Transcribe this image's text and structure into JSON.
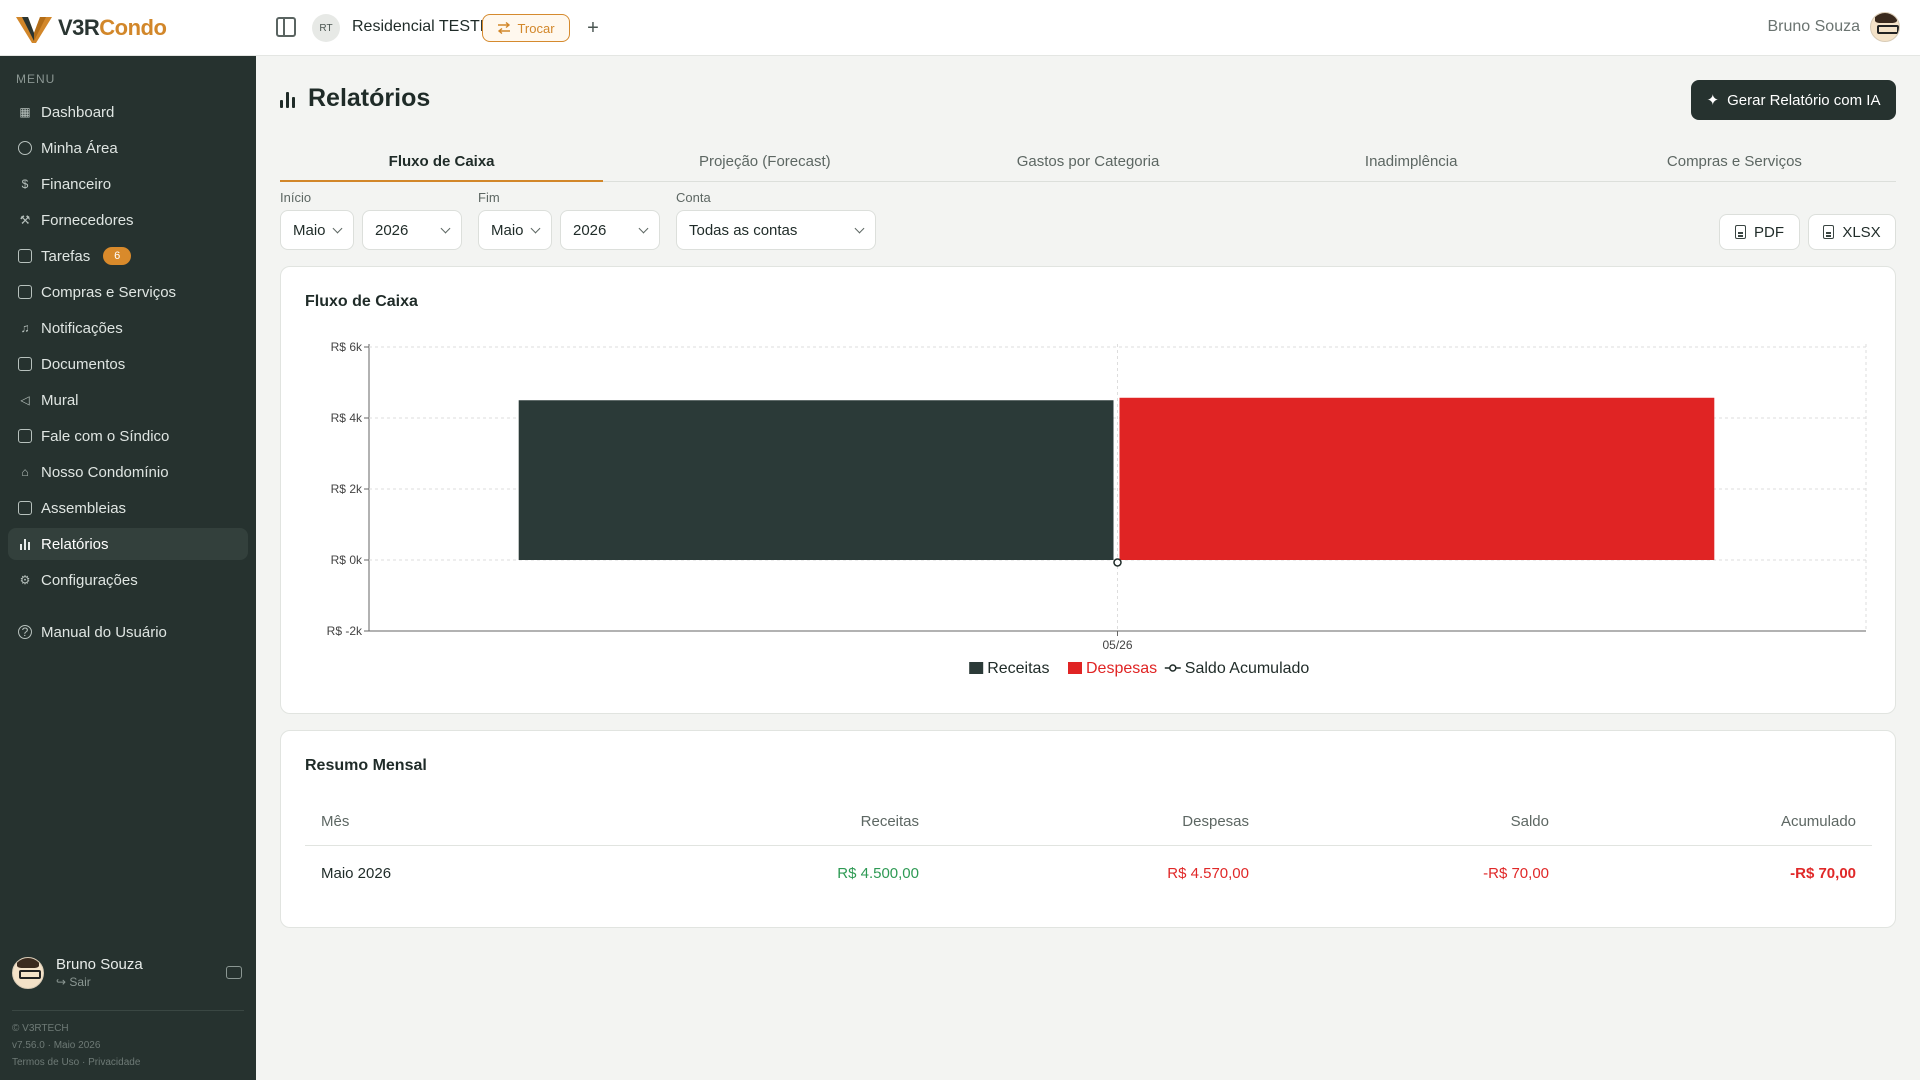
{
  "app": {
    "logo_prefix": "V3R",
    "logo_suffix": "Condo"
  },
  "header": {
    "condo_initials": "RT",
    "condo_name": "Residencial TESTE",
    "switch_label": "Trocar",
    "add_label": "+",
    "user_name": "Bruno Souza"
  },
  "sidebar": {
    "menu_label": "MENU",
    "items": [
      {
        "label": "Dashboard",
        "icon": "dashboard-icon"
      },
      {
        "label": "Minha Área",
        "icon": "user-circle-icon"
      },
      {
        "label": "Financeiro",
        "icon": "dollar-icon"
      },
      {
        "label": "Fornecedores",
        "icon": "wrench-icon"
      },
      {
        "label": "Tarefas",
        "icon": "clipboard-icon",
        "badge": "6"
      },
      {
        "label": "Compras e Serviços",
        "icon": "file-icon"
      },
      {
        "label": "Notificações",
        "icon": "bell-icon"
      },
      {
        "label": "Documentos",
        "icon": "folder-icon"
      },
      {
        "label": "Mural",
        "icon": "megaphone-icon"
      },
      {
        "label": "Fale com o Síndico",
        "icon": "chat-icon"
      },
      {
        "label": "Nosso Condomínio",
        "icon": "home-icon"
      },
      {
        "label": "Assembleias",
        "icon": "clipboard-icon"
      },
      {
        "label": "Relatórios",
        "icon": "bar-chart-icon",
        "active": true
      },
      {
        "label": "Configurações",
        "icon": "gear-icon"
      },
      {
        "label": "Manual do Usuário",
        "icon": "help-icon"
      }
    ],
    "user_name": "Bruno Souza",
    "logout_label": "Sair",
    "footer_company": "© V3RTECH",
    "footer_version": "v7.56.0 · Maio 2026",
    "footer_terms": "Termos de Uso",
    "footer_privacy": "Privacidade"
  },
  "page": {
    "title": "Relatórios",
    "ai_button": "Gerar Relatório com IA",
    "tabs": [
      "Fluxo de Caixa",
      "Projeção (Forecast)",
      "Gastos por Categoria",
      "Inadimplência",
      "Compras e Serviços"
    ],
    "active_tab": 0
  },
  "filters": {
    "start_label": "Início",
    "start_month": "Maio",
    "start_year": "2026",
    "end_label": "Fim",
    "end_month": "Maio",
    "end_year": "2026",
    "account_label": "Conta",
    "account_value": "Todas as contas",
    "pdf_label": "PDF",
    "xlsx_label": "XLSX"
  },
  "chart_card": {
    "title": "Fluxo de Caixa"
  },
  "chart_data": {
    "type": "bar",
    "title": "Fluxo de Caixa",
    "categories": [
      "05/26"
    ],
    "series": [
      {
        "name": "Receitas",
        "kind": "bar",
        "color": "#2b3a38",
        "values": [
          4500
        ]
      },
      {
        "name": "Despesas",
        "kind": "bar",
        "color": "#e02424",
        "values": [
          4570
        ]
      },
      {
        "name": "Saldo Acumulado",
        "kind": "line",
        "color": "#1f2b28",
        "values": [
          -70
        ]
      }
    ],
    "ylim": [
      -2000,
      6000
    ],
    "yticks": [
      -2000,
      0,
      2000,
      4000,
      6000
    ],
    "ytick_labels": [
      "R$ -2k",
      "R$ 0k",
      "R$ 2k",
      "R$ 4k",
      "R$ 6k"
    ],
    "grid": true,
    "legend_position": "bottom"
  },
  "summary": {
    "title": "Resumo Mensal",
    "columns": [
      "Mês",
      "Receitas",
      "Despesas",
      "Saldo",
      "Acumulado"
    ],
    "rows": [
      {
        "month": "Maio 2026",
        "income": "R$ 4.500,00",
        "expense": "R$ 4.570,00",
        "balance": "-R$ 70,00",
        "cumulative": "-R$ 70,00"
      }
    ]
  },
  "colors": {
    "sidebar": "#26322f",
    "accent": "#d2872a",
    "income": "#2b3a38",
    "expense": "#e02424"
  }
}
